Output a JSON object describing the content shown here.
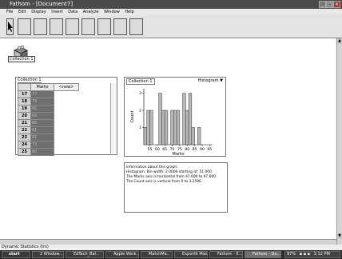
{
  "window": {
    "title": "Fathom - [Document7]"
  },
  "menu": [
    "File",
    "Edit",
    "Display",
    "Insert",
    "Data",
    "Analyze",
    "Window",
    "Help"
  ],
  "collection_icon": {
    "label": "Collection 1"
  },
  "case_table": {
    "title": "Collection 1",
    "header_col1": "Marks",
    "header_col2": "<new>",
    "rows": [
      {
        "n": "17",
        "v": "77"
      },
      {
        "n": "18",
        "v": "79"
      },
      {
        "n": "19",
        "v": "80"
      },
      {
        "n": "20",
        "v": "60"
      },
      {
        "n": "21",
        "v": "80"
      },
      {
        "n": "22",
        "v": "61"
      },
      {
        "n": "23",
        "v": "81"
      },
      {
        "n": "24",
        "v": "73"
      },
      {
        "n": "25",
        "v": "80"
      }
    ]
  },
  "graph": {
    "title": "Collection 1",
    "type_label": "Histogram",
    "ylabel": "Count",
    "xlabel": "Marks"
  },
  "chart_data": {
    "type": "bar",
    "title": "",
    "xlabel": "Marks",
    "ylabel": "Count",
    "bin_width": 2,
    "bin_starts": [
      51,
      53,
      55,
      57,
      59,
      61,
      63,
      65,
      67,
      69,
      71,
      73,
      75,
      77,
      79,
      81,
      83,
      85,
      87
    ],
    "counts": [
      1,
      2,
      2,
      0,
      0,
      3,
      2,
      2,
      0,
      2,
      2,
      2,
      0,
      3,
      2,
      3,
      1,
      0,
      1
    ],
    "xticks": [
      "55",
      "60",
      "65",
      "70",
      "75",
      "80",
      "85",
      "90",
      "95"
    ],
    "xtick_values": [
      55,
      60,
      65,
      70,
      75,
      80,
      85,
      90,
      95
    ],
    "yticks": [
      "1",
      "2",
      "3"
    ],
    "xlim": [
      51,
      97
    ],
    "ylim": [
      0,
      3.2596
    ],
    "grid": false
  },
  "info": {
    "lines": [
      "Information about this graph:",
      "Histogram: Bin width: 2.0000  starting at: 51.000",
      "The Marks axis is horizontal  from 47.600 to 97.600",
      "The Count axis is vertical  from 0 to 3.2596"
    ]
  },
  "status": "Dynamic Statistics (tm)",
  "taskbar": {
    "start": "start",
    "items": [
      "2 Window...",
      "EdTech_Bal...",
      "Apple Work...",
      "MatchMa...",
      "ExportIt Mac...",
      "Fathom - E...",
      "Fathom - Do..."
    ],
    "tray": "97%",
    "clock": "1:12 PM"
  }
}
